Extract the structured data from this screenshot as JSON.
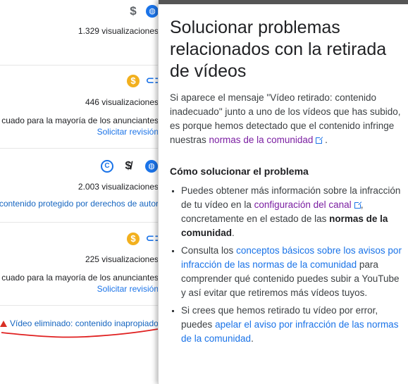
{
  "videos": [
    {
      "views": "1.329 visualizaciones"
    },
    {
      "views": "446 visualizaciones",
      "status": "cuado para la mayoría de los anunciantes",
      "action": "Solicitar revisión"
    },
    {
      "views": "2.003 visualizaciones",
      "status": "contenido protegido por derechos de autor"
    },
    {
      "views": "225 visualizaciones",
      "status": "cuado para la mayoría de los anunciantes",
      "action": "Solicitar revisión"
    }
  ],
  "removed_notice": "Vídeo eliminado: contenido inapropiado",
  "panel": {
    "title": "Solucionar problemas relacionados con la retirada de vídeos",
    "intro_text": "Si aparece el mensaje \"Vídeo retirado: contenido inadecuado\" junto a uno de los vídeos que has subido, es porque hemos detectado que el contenido infringe nuestras",
    "intro_link": "normas de la comunidad",
    "intro_end": ".",
    "section_heading": "Cómo solucionar el problema",
    "bullet1": {
      "text": "Puedes obtener más información sobre la infracción de tu vídeo en la",
      "link": "configuración del canal",
      "text2": ", concretamente en el estado de las",
      "bold": "normas de la comunidad",
      "end": "."
    },
    "bullet2": {
      "text": "Consulta los",
      "link": "conceptos básicos sobre los avisos por infracción de las normas de la comunidad",
      "text2": "para comprender qué contenido puedes subir a YouTube y así evitar que retiremos más vídeos tuyos."
    },
    "bullet3": {
      "text": "Si crees que hemos retirado tu vídeo por error, puedes",
      "link": "apelar el aviso por infracción de las normas de la comunidad",
      "end": "."
    }
  },
  "colors": {
    "link_blue": "#1a73e8",
    "visited_purple": "#7b1fa2",
    "monetization_gold": "#f2b01e",
    "alert_red": "#d93025"
  }
}
